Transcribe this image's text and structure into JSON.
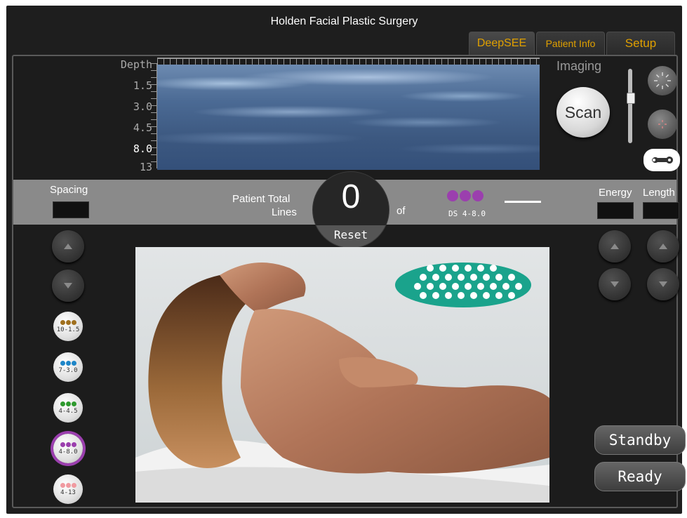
{
  "app": {
    "title": "Holden Facial Plastic Surgery"
  },
  "tabs": [
    {
      "label": "DeepSEE"
    },
    {
      "label": "Patient  Info"
    },
    {
      "label": "Setup"
    }
  ],
  "imaging": {
    "depth_title": "Depth",
    "depths": [
      "1.5",
      "3.0",
      "4.5",
      "8.0",
      "13"
    ],
    "active_depth": "8.0",
    "imaging_label": "Imaging",
    "scan_label": "Scan"
  },
  "info_band": {
    "spacing_label": "Spacing",
    "patient_total_line1": "Patient Total",
    "patient_total_line2": "Lines",
    "lines_value": "0",
    "of_label": "of",
    "reset_label": "Reset",
    "transducer_label": "DS 4-8.0",
    "energy_label": "Energy",
    "length_label": "Length"
  },
  "transducers": [
    {
      "label": "10-1.5",
      "color": "#a0701e"
    },
    {
      "label": "7-3.0",
      "color": "#1e86c8"
    },
    {
      "label": "4-4.5",
      "color": "#2e9a2e"
    },
    {
      "label": "4-8.0",
      "color": "#9b3fae",
      "selected": true
    },
    {
      "label": "4-13",
      "color": "#f09aa0"
    }
  ],
  "status": {
    "standby_label": "Standby",
    "ready_label": "Ready"
  },
  "colors": {
    "tab_text": "#e0a000",
    "teal": "#1aa38c",
    "selected_ring": "#9b3fae"
  }
}
